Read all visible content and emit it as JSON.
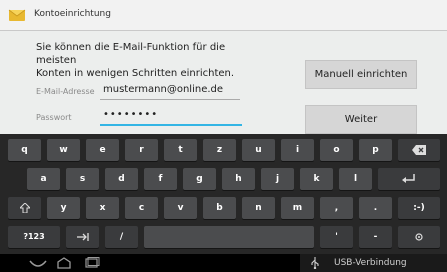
{
  "titlebar": {
    "title": "Kontoeinrichtung"
  },
  "content": {
    "description_line1": "Sie können die E-Mail-Funktion für die meisten",
    "description_line2": "Konten in wenigen Schritten einrichten.",
    "email_label": "E-Mail-Adresse",
    "email_value": "mustermann@online.de",
    "password_label": "Passwort",
    "password_value": "••••••••",
    "manual_button": "Manuell einrichten",
    "next_button": "Weiter"
  },
  "keyboard": {
    "row1": [
      "q",
      "w",
      "e",
      "r",
      "t",
      "z",
      "u",
      "i",
      "o",
      "p"
    ],
    "row2": [
      "a",
      "s",
      "d",
      "f",
      "g",
      "h",
      "j",
      "k",
      "l"
    ],
    "row3": [
      "y",
      "x",
      "c",
      "v",
      "b",
      "n",
      "m",
      ",",
      "."
    ],
    "special": {
      "backspace_icon": "backspace-icon",
      "enter_icon": "enter-icon",
      "shift_icon": "shift-icon",
      "symbols": "?123",
      "tab_icon": "tab-icon",
      "slash": "/",
      "quote": "'",
      "dash": "-",
      "smiley": ":-)",
      "settings_icon": "keyboard-settings-icon"
    }
  },
  "statusbar": {
    "usb_text": "USB-Verbindung"
  },
  "colors": {
    "accent": "#33b5e5",
    "keyboard_bg": "#272727",
    "key_bg": "#4b4c4e"
  }
}
